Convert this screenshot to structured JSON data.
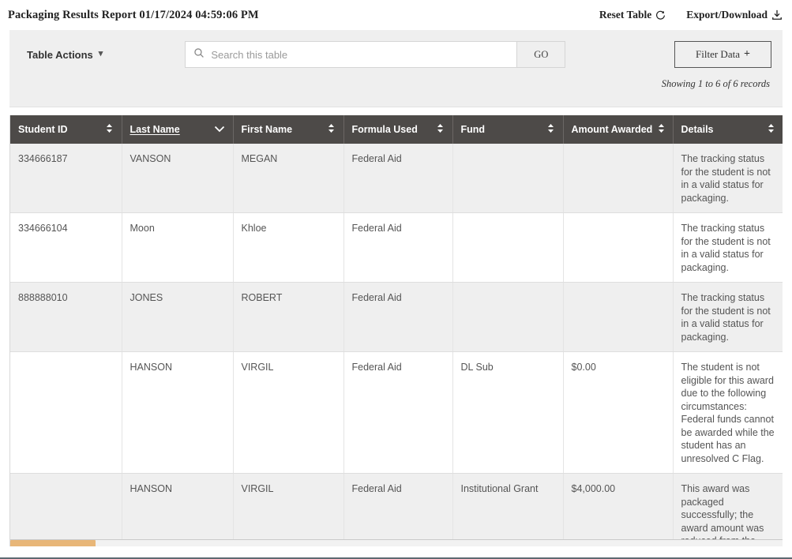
{
  "header": {
    "title": "Packaging Results Report 01/17/2024 04:59:06 PM",
    "reset_label": "Reset Table",
    "reset_icon": "refresh-icon",
    "export_label": "Export/Download",
    "export_icon": "download-icon"
  },
  "toolbar": {
    "table_actions_label": "Table Actions",
    "table_actions_icon": "chevron-down-icon",
    "search_icon": "search-icon",
    "search_value": "",
    "search_placeholder": "Search this table",
    "go_label": "GO",
    "filter_label": "Filter Data",
    "filter_icon": "plus-icon",
    "records_text": "Showing 1 to 6 of 6 records"
  },
  "table": {
    "columns": [
      {
        "label": "Student ID",
        "sorted": false,
        "sort_icon": "sort-both-icon"
      },
      {
        "label": "Last Name",
        "sorted": true,
        "sort_icon": "chevron-down-icon"
      },
      {
        "label": "First Name",
        "sorted": false,
        "sort_icon": "sort-both-icon"
      },
      {
        "label": "Formula Used",
        "sorted": false,
        "sort_icon": "sort-both-icon"
      },
      {
        "label": "Fund",
        "sorted": false,
        "sort_icon": "sort-both-icon"
      },
      {
        "label": "Amount Awarded",
        "sorted": false,
        "sort_icon": "sort-both-icon"
      },
      {
        "label": "Details",
        "sorted": false,
        "sort_icon": "sort-both-icon"
      }
    ],
    "rows": [
      {
        "student_id": "334666187",
        "last_name": "VANSON",
        "first_name": "MEGAN",
        "formula_used": "Federal Aid",
        "fund": "",
        "amount_awarded": "",
        "details": "The tracking status for the student is not in a valid status for packaging."
      },
      {
        "student_id": "334666104",
        "last_name": "Moon",
        "first_name": "Khloe",
        "formula_used": "Federal Aid",
        "fund": "",
        "amount_awarded": "",
        "details": "The tracking status for the student is not in a valid status for packaging."
      },
      {
        "student_id": "888888010",
        "last_name": "JONES",
        "first_name": "ROBERT",
        "formula_used": "Federal Aid",
        "fund": "",
        "amount_awarded": "",
        "details": "The tracking status for the student is not in a valid status for packaging."
      },
      {
        "student_id": "",
        "last_name": "HANSON",
        "first_name": "VIRGIL",
        "formula_used": "Federal Aid",
        "fund": "DL Sub",
        "amount_awarded": "$0.00",
        "details": "The student is not eligible for this award due to the following circumstances: Federal funds cannot be awarded while the student has an unresolved C Flag."
      },
      {
        "student_id": "",
        "last_name": "HANSON",
        "first_name": "VIRGIL",
        "formula_used": "Federal Aid",
        "fund": "Institutional Grant",
        "amount_awarded": "$4,000.00",
        "details": "This award was packaged successfully; the award amount was reduced from the"
      }
    ]
  },
  "scrollbar": {
    "orientation": "horizontal",
    "thumb_color": "#e8b678"
  }
}
